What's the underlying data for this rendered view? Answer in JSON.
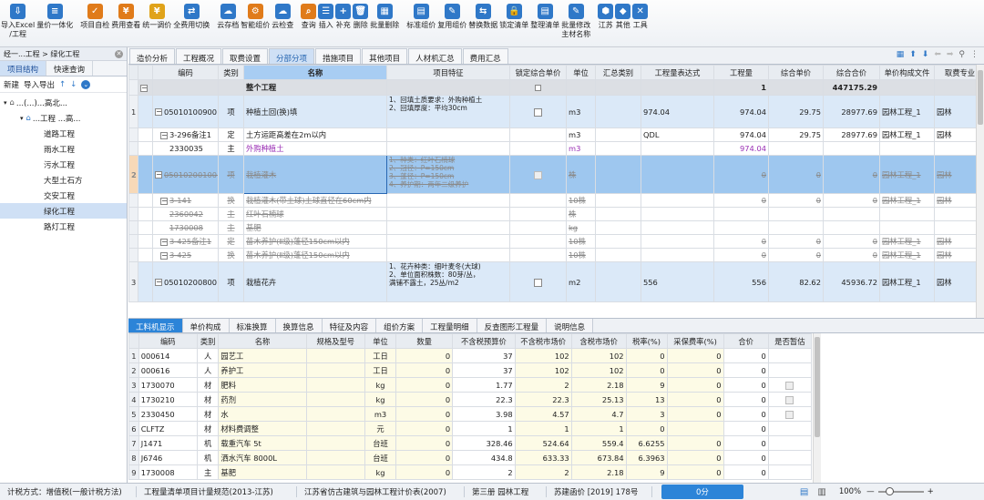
{
  "toolbar": [
    {
      "label": "导入Excel\n/工程",
      "icon": "import-excel-icon",
      "color": "#2f78c8",
      "glyph": "⇩"
    },
    {
      "label": "量价一体化",
      "icon": "price-integration-icon",
      "color": "#2f78c8",
      "glyph": "≡"
    },
    {
      "label": "项目自检",
      "icon": "self-check-icon",
      "color": "#e07b1a",
      "glyph": "✓"
    },
    {
      "label": "费用查看",
      "icon": "fee-view-icon",
      "color": "#e07b1a",
      "glyph": "¥"
    },
    {
      "label": "统一调价",
      "icon": "unify-price-icon",
      "color": "#e0a31a",
      "glyph": "¥"
    },
    {
      "label": "全费用切换",
      "icon": "full-fee-switch-icon",
      "color": "#2f78c8",
      "glyph": "⇄"
    },
    {
      "label": "云存档",
      "icon": "cloud-save-icon",
      "color": "#2f78c8",
      "glyph": "☁"
    },
    {
      "label": "智能组价",
      "icon": "smart-price-icon",
      "color": "#e07b1a",
      "glyph": "⚙"
    },
    {
      "label": "云检查",
      "icon": "cloud-check-icon",
      "color": "#2f78c8",
      "glyph": "☁"
    },
    {
      "label": "查询",
      "icon": "query-icon",
      "color": "#e07b1a",
      "glyph": "⌕"
    },
    {
      "label": "插入",
      "icon": "insert-icon",
      "color": "#2f78c8",
      "glyph": "☰"
    },
    {
      "label": "补充",
      "icon": "supplement-icon",
      "color": "#2f78c8",
      "glyph": "+"
    },
    {
      "label": "删除",
      "icon": "delete-icon",
      "color": "#2f78c8",
      "glyph": "🗑"
    },
    {
      "label": "批量删除",
      "icon": "batch-delete-icon",
      "color": "#2f78c8",
      "glyph": "▦"
    },
    {
      "label": "标准组价",
      "icon": "standard-price-icon",
      "color": "#2f78c8",
      "glyph": "▤"
    },
    {
      "label": "复用组价",
      "icon": "reuse-price-icon",
      "color": "#2f78c8",
      "glyph": "✎"
    },
    {
      "label": "替换数据",
      "icon": "replace-data-icon",
      "color": "#2f78c8",
      "glyph": "⇆"
    },
    {
      "label": "锁定清单",
      "icon": "lock-list-icon",
      "color": "#2f78c8",
      "glyph": "🔒"
    },
    {
      "label": "整理清单",
      "icon": "organize-list-icon",
      "color": "#2f78c8",
      "glyph": "▤"
    },
    {
      "label": "批量修改\n主材名称",
      "icon": "batch-rename-icon",
      "color": "#2f78c8",
      "glyph": "✎"
    },
    {
      "label": "江苏",
      "icon": "jiangsu-icon",
      "color": "#2f78c8",
      "glyph": "⬢"
    },
    {
      "label": "其他",
      "icon": "other-icon",
      "color": "#2f78c8",
      "glyph": "◆"
    },
    {
      "label": "工具",
      "icon": "tools-icon",
      "color": "#2f78c8",
      "glyph": "✕"
    }
  ],
  "left": {
    "breadcrumb": "经一...工程 > 绿化工程",
    "tabs": [
      "项目结构",
      "快速查询"
    ],
    "tools": {
      "new": "新建",
      "import": "导入导出"
    },
    "root": "...(...)...高北...",
    "child": "...工程 ...高...",
    "items": [
      "道路工程",
      "雨水工程",
      "污水工程",
      "大型土石方",
      "交安工程",
      "绿化工程",
      "路灯工程"
    ]
  },
  "main_tabs": [
    "造价分析",
    "工程概况",
    "取费设置",
    "分部分项",
    "措施项目",
    "其他项目",
    "人材机汇总",
    "费用汇总"
  ],
  "grid": {
    "headers": [
      "编码",
      "类别",
      "名称",
      "项目特征",
      "锁定综合单价",
      "单位",
      "汇总类别",
      "工程量表达式",
      "工程量",
      "综合单价",
      "综合合价",
      "单价构成文件",
      "取费专业"
    ],
    "root_row": {
      "name": "整个工程",
      "qty": "1",
      "total": "447175.29"
    },
    "rows": [
      {
        "no": "1",
        "code": "050101009001",
        "type": "项",
        "name": "种植土回(换)填",
        "feat": "1、回填土质要求：外购种植土\n2、回填厚度：平均30cm",
        "unit": "m3",
        "expr": "974.04",
        "qty": "974.04",
        "price": "29.75",
        "total": "28977.69",
        "file": "园林工程_1",
        "spec": "园林"
      },
      {
        "no": "",
        "code": "3-296备注1",
        "type": "定",
        "name": "土方运距高差在2m以内",
        "feat": "",
        "unit": "m3",
        "expr": "QDL",
        "qty": "974.04",
        "price": "29.75",
        "total": "28977.69",
        "file": "园林工程_1",
        "spec": "园林"
      },
      {
        "no": "",
        "code": "2330035",
        "type": "主",
        "name": "外购种植土",
        "feat": "",
        "unit": "m3",
        "expr": "",
        "qty": "974.04",
        "price": "",
        "total": "",
        "file": "",
        "spec": ""
      },
      {
        "no": "2",
        "code": "050102001001",
        "type": "项",
        "name": "栽植灌木",
        "feat": "1、种类：红叶石楠球\n2、冠径：P=150cm\n3、蓬径：P=150cm\n4、养护期：两年二级养护",
        "unit": "株",
        "expr": "",
        "qty": "0",
        "price": "0",
        "total": "0",
        "file": "园林工程_1",
        "spec": "园林"
      },
      {
        "no": "",
        "code": "3-141",
        "type": "换",
        "name": "栽植灌木(带土球)土球直径在60cm内",
        "feat": "",
        "unit": "10株",
        "expr": "",
        "qty": "0",
        "price": "0",
        "total": "0",
        "file": "园林工程_1",
        "spec": "园林"
      },
      {
        "no": "",
        "code": "2360042",
        "type": "主",
        "name": "红叶石楠球",
        "feat": "",
        "unit": "株",
        "expr": "",
        "qty": "",
        "price": "",
        "total": "",
        "file": "",
        "spec": ""
      },
      {
        "no": "",
        "code": "1730008",
        "type": "主",
        "name": "基肥",
        "feat": "",
        "unit": "kg",
        "expr": "",
        "qty": "",
        "price": "",
        "total": "",
        "file": "",
        "spec": ""
      },
      {
        "no": "",
        "code": "3-425备注1",
        "type": "定",
        "name": "苗木养护(Ⅱ级)蓬径150cm以内",
        "feat": "",
        "unit": "10株",
        "expr": "",
        "qty": "0",
        "price": "0",
        "total": "0",
        "file": "园林工程_1",
        "spec": "园林"
      },
      {
        "no": "",
        "code": "3-425",
        "type": "换",
        "name": "苗木养护(Ⅱ级)蓬径150cm以内",
        "feat": "",
        "unit": "10株",
        "expr": "",
        "qty": "0",
        "price": "0",
        "total": "0",
        "file": "园林工程_1",
        "spec": "园林"
      },
      {
        "no": "3",
        "code": "050102008001",
        "type": "项",
        "name": "栽植花卉",
        "feat": "1、花卉种类：细叶麦冬(大球)\n2、单位面积株数：80芽/丛，\n满铺不露土，25丛/m2",
        "unit": "m2",
        "expr": "556",
        "qty": "556",
        "price": "82.62",
        "total": "45936.72",
        "file": "园林工程_1",
        "spec": "园林"
      }
    ]
  },
  "bottom_tabs": [
    "工料机显示",
    "单价构成",
    "标准换算",
    "换算信息",
    "特征及内容",
    "组价方案",
    "工程量明细",
    "反查图形工程量",
    "说明信息"
  ],
  "lower": {
    "headers": [
      "编码",
      "类别",
      "名称",
      "规格及型号",
      "单位",
      "数量",
      "不含税预算价",
      "不含税市场价",
      "含税市场价",
      "税率(%)",
      "采保费率(%)",
      "合价",
      "是否暂估"
    ],
    "rows": [
      {
        "no": "1",
        "code": "000614",
        "type": "人",
        "name": "园艺工",
        "spec": "",
        "unit": "工日",
        "qty": "0",
        "p1": "37",
        "p2": "102",
        "p3": "102",
        "tax": "0",
        "fee": "0",
        "total": "0",
        "cb": false
      },
      {
        "no": "2",
        "code": "000616",
        "type": "人",
        "name": "养护工",
        "spec": "",
        "unit": "工日",
        "qty": "0",
        "p1": "37",
        "p2": "102",
        "p3": "102",
        "tax": "0",
        "fee": "0",
        "total": "0",
        "cb": false
      },
      {
        "no": "3",
        "code": "1730070",
        "type": "材",
        "name": "肥料",
        "spec": "",
        "unit": "kg",
        "qty": "0",
        "p1": "1.77",
        "p2": "2",
        "p3": "2.18",
        "tax": "9",
        "fee": "0",
        "total": "0",
        "cb": true
      },
      {
        "no": "4",
        "code": "1730210",
        "type": "材",
        "name": "药剂",
        "spec": "",
        "unit": "kg",
        "qty": "0",
        "p1": "22.3",
        "p2": "22.3",
        "p3": "25.13",
        "tax": "13",
        "fee": "0",
        "total": "0",
        "cb": true
      },
      {
        "no": "5",
        "code": "2330450",
        "type": "材",
        "name": "水",
        "spec": "",
        "unit": "m3",
        "qty": "0",
        "p1": "3.98",
        "p2": "4.57",
        "p3": "4.7",
        "tax": "3",
        "fee": "0",
        "total": "0",
        "cb": true
      },
      {
        "no": "6",
        "code": "CLFTZ",
        "type": "材",
        "name": "材料费调整",
        "spec": "",
        "unit": "元",
        "qty": "0",
        "p1": "1",
        "p2": "1",
        "p3": "1",
        "tax": "0",
        "fee": "",
        "total": "0",
        "cb": false
      },
      {
        "no": "7",
        "code": "J1471",
        "type": "机",
        "name": "载重汽车 5t",
        "spec": "",
        "unit": "台班",
        "qty": "0",
        "p1": "328.46",
        "p2": "524.64",
        "p3": "559.4",
        "tax": "6.6255",
        "fee": "0",
        "total": "0",
        "cb": false
      },
      {
        "no": "8",
        "code": "J6746",
        "type": "机",
        "name": "洒水汽车 8000L",
        "spec": "",
        "unit": "台班",
        "qty": "0",
        "p1": "434.8",
        "p2": "633.33",
        "p3": "673.84",
        "tax": "6.3963",
        "fee": "0",
        "total": "0",
        "cb": false
      },
      {
        "no": "9",
        "code": "1730008",
        "type": "主",
        "name": "基肥",
        "spec": "",
        "unit": "kg",
        "qty": "0",
        "p1": "2",
        "p2": "2",
        "p3": "2.18",
        "tax": "9",
        "fee": "0",
        "total": "0",
        "cb": false
      }
    ]
  },
  "status": {
    "mode": "计税方式：增值税(一般计税方法)",
    "rule": "工程量清单项目计量规范(2013-江苏)",
    "quota": "江苏省仿古建筑与园林工程计价表(2007)",
    "book": "第三册 园林工程",
    "doc": "苏建函价 [2019] 178号",
    "score": "0分",
    "zoom": "100%"
  }
}
